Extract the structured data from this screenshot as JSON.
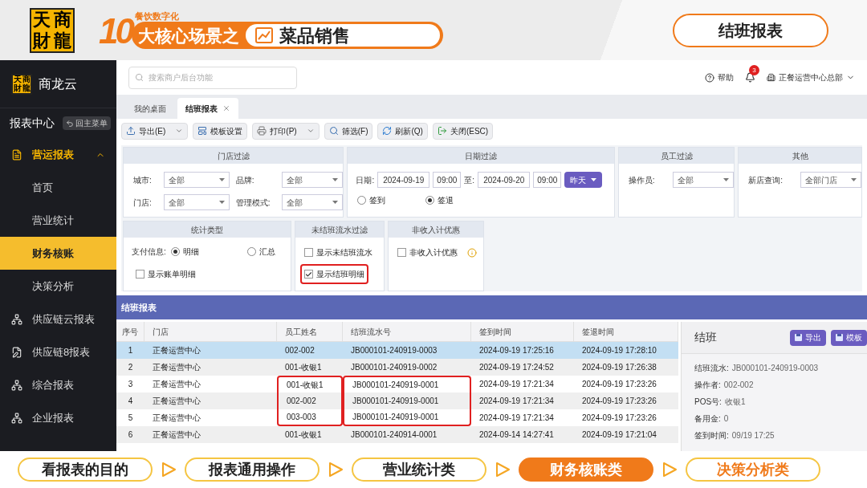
{
  "banner": {
    "logo_chars": [
      "天",
      "商",
      "財",
      "龍"
    ],
    "subtitle": "餐饮数字化",
    "number": "10",
    "headline": "大核心场景之",
    "topic": "菜品销售",
    "page_title": "结班报表"
  },
  "sidebar": {
    "logo_chars": [
      "天",
      "商",
      "財",
      "龍"
    ],
    "brand": "商龙云",
    "section": "报表中心",
    "back_button": "回主菜单",
    "items": [
      {
        "label": "营运报表",
        "kind": "document",
        "expanded": true,
        "children": [
          {
            "label": "首页",
            "selected": false
          },
          {
            "label": "营业统计",
            "selected": false
          },
          {
            "label": "财务核账",
            "selected": true
          },
          {
            "label": "决策分析",
            "selected": false
          }
        ]
      },
      {
        "label": "供应链云报表",
        "kind": "tree",
        "expanded": false
      },
      {
        "label": "供应链8报表",
        "kind": "edit",
        "expanded": false
      },
      {
        "label": "综合报表",
        "kind": "tree",
        "expanded": false
      },
      {
        "label": "企业报表",
        "kind": "tree",
        "expanded": false
      }
    ]
  },
  "header": {
    "search_placeholder": "搜索商户后台功能",
    "help": "帮助",
    "notifications": "3",
    "org": "正餐运营中心总部"
  },
  "tabs": [
    {
      "label": "我的桌面",
      "selected": false,
      "closable": false
    },
    {
      "label": "结班报表",
      "selected": true,
      "closable": true
    }
  ],
  "toolbar": [
    {
      "label": "导出(E)",
      "kind": "export",
      "dropdown": true
    },
    {
      "label": "模板设置",
      "kind": "template",
      "dropdown": false
    },
    {
      "label": "打印(P)",
      "kind": "print",
      "dropdown": true
    },
    {
      "label": "筛选(F)",
      "kind": "filter",
      "dropdown": false
    },
    {
      "label": "刷新(Q)",
      "kind": "refresh",
      "dropdown": false
    },
    {
      "label": "关闭(ESC)",
      "kind": "close",
      "dropdown": false
    }
  ],
  "filter_rows": [
    [
      {
        "title": "门店过滤",
        "kind": "selects",
        "fields": [
          {
            "label": "城市:",
            "value": "全部"
          },
          {
            "label": "品牌:",
            "value": "全部"
          },
          {
            "label": "门店:",
            "value": "全部"
          },
          {
            "label": "管理模式:",
            "value": "全部"
          }
        ]
      },
      {
        "title": "日期过滤",
        "kind": "date",
        "date_label": "日期:",
        "from_date": "2024-09-19",
        "from_time": "09:00",
        "to_label": "至:",
        "to_date": "2024-09-20",
        "to_time": "09:00",
        "quick_button": "昨天",
        "radios": [
          {
            "label": "签到",
            "selected": false
          },
          {
            "label": "签退",
            "selected": true
          }
        ]
      },
      {
        "title": "员工过滤",
        "kind": "selects",
        "fields": [
          {
            "label": "操作员:",
            "value": "全部"
          }
        ]
      },
      {
        "title": "其他",
        "kind": "selects",
        "fields": [
          {
            "label": "新店查询:",
            "value": "全部门店"
          }
        ]
      }
    ],
    [
      {
        "title": "统计类型",
        "kind": "stat",
        "radio_label": "支付信息:",
        "radios": [
          {
            "label": "明细",
            "selected": true
          },
          {
            "label": "汇总",
            "selected": false
          }
        ],
        "checkboxes": [
          {
            "label": "显示账单明细",
            "checked": false,
            "highlighted": false,
            "info": false
          }
        ]
      },
      {
        "title": "未结班流水过滤",
        "kind": "checks",
        "checkboxes": [
          {
            "label": "显示未结班流水",
            "checked": false,
            "highlighted": false,
            "info": false
          },
          {
            "label": "显示结班明细",
            "checked": true,
            "highlighted": true,
            "info": false
          }
        ]
      },
      {
        "title": "非收入计优惠",
        "kind": "checks",
        "checkboxes": [
          {
            "label": "非收入计优惠",
            "checked": false,
            "highlighted": false,
            "info": true
          }
        ]
      }
    ]
  ],
  "report": {
    "title": "结班报表",
    "columns": [
      "序号",
      "门店",
      "员工姓名",
      "结班流水号",
      "签到时间",
      "签退时间"
    ],
    "rows": [
      {
        "cells": [
          "1",
          "正餐运营中心",
          "002-002",
          "JB000101-240919-0003",
          "2024-09-19 17:25:16",
          "2024-09-19 17:28:10"
        ],
        "selected": true,
        "highlighted": false
      },
      {
        "cells": [
          "2",
          "正餐运营中心",
          "001-收银1",
          "JB000101-240919-0002",
          "2024-09-19 17:24:52",
          "2024-09-19 17:26:38"
        ],
        "selected": false,
        "highlighted": false
      },
      {
        "cells": [
          "3",
          "正餐运营中心",
          "001-收银1",
          "JB000101-240919-0001",
          "2024-09-19 17:21:34",
          "2024-09-19 17:23:26"
        ],
        "selected": false,
        "highlighted": true
      },
      {
        "cells": [
          "4",
          "正餐运营中心",
          "002-002",
          "JB000101-240919-0001",
          "2024-09-19 17:21:34",
          "2024-09-19 17:23:26"
        ],
        "selected": false,
        "highlighted": true
      },
      {
        "cells": [
          "5",
          "正餐运营中心",
          "003-003",
          "JB000101-240919-0001",
          "2024-09-19 17:21:34",
          "2024-09-19 17:23:26"
        ],
        "selected": false,
        "highlighted": true
      },
      {
        "cells": [
          "6",
          "正餐运营中心",
          "001-收银1",
          "JB000101-240914-0001",
          "2024-09-14 14:27:41",
          "2024-09-19 17:21:04"
        ],
        "selected": false,
        "highlighted": false
      }
    ]
  },
  "detail": {
    "title": "结班",
    "buttons": [
      "导出",
      "模板"
    ],
    "fields": [
      {
        "label": "结班流水:",
        "value": "JB000101-240919-0003"
      },
      {
        "label": "操作者:",
        "value": "002-002"
      },
      {
        "label": "POS号:",
        "value": "收银1"
      },
      {
        "label": "备用金:",
        "value": "0"
      },
      {
        "label": "签到时间:",
        "value": "09/19 17:25"
      }
    ]
  },
  "steps": [
    {
      "label": "看报表的目的",
      "selected": false,
      "emphasized": false
    },
    {
      "label": "报表通用操作",
      "selected": false,
      "emphasized": false
    },
    {
      "label": "营业统计类",
      "selected": false,
      "emphasized": false
    },
    {
      "label": "财务核账类",
      "selected": true,
      "emphasized": false
    },
    {
      "label": "决策分析类",
      "selected": false,
      "emphasized": true
    }
  ]
}
